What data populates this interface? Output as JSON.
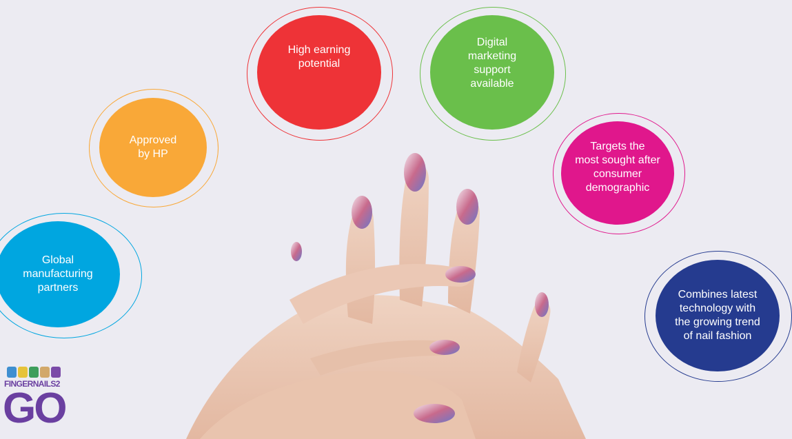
{
  "bubbles": [
    {
      "id": "global",
      "label": "Global\nmanufacturing\npartners",
      "color": "#00a6e0"
    },
    {
      "id": "approved",
      "label": "Approved\nby HP",
      "color": "#f9a838"
    },
    {
      "id": "earning",
      "label": "High earning\npotential",
      "color": "#ee3337"
    },
    {
      "id": "digital",
      "label": "Digital\nmarketing\nsupport\navailable",
      "color": "#6abf4b"
    },
    {
      "id": "targets",
      "label": "Targets the\nmost sought after\nconsumer\ndemographic",
      "color": "#e0178c"
    },
    {
      "id": "combines",
      "label": "Combines latest\ntechnology with\nthe growing trend\nof nail fashion",
      "color": "#253b8f"
    }
  ],
  "logo": {
    "word": "FINGERNAILS2",
    "big": "GO",
    "color": "#6a3fa0"
  },
  "photo": {
    "icon": "manicured-hands-photo"
  }
}
